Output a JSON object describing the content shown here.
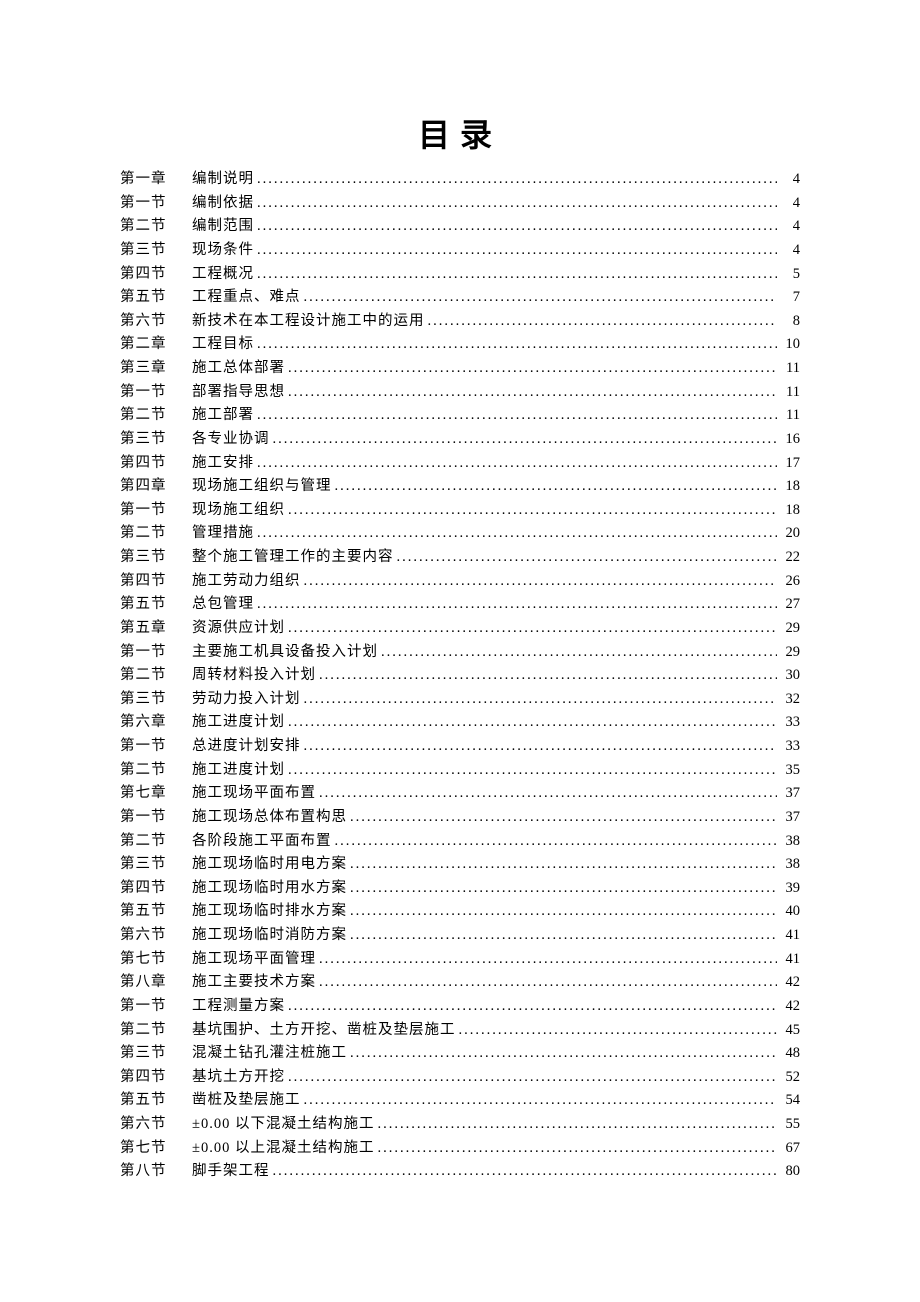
{
  "title": "目录",
  "toc": [
    {
      "label": "第一章",
      "text": "编制说明",
      "page": "4"
    },
    {
      "label": "第一节",
      "text": "编制依据",
      "page": "4"
    },
    {
      "label": "第二节",
      "text": "编制范围",
      "page": "4"
    },
    {
      "label": "第三节",
      "text": "现场条件",
      "page": "4"
    },
    {
      "label": "第四节",
      "text": "工程概况",
      "page": "5"
    },
    {
      "label": "第五节",
      "text": "工程重点、难点",
      "page": "7"
    },
    {
      "label": "第六节",
      "text": "新技术在本工程设计施工中的运用",
      "page": "8"
    },
    {
      "label": "第二章",
      "text": "工程目标",
      "page": "10"
    },
    {
      "label": "第三章",
      "text": "施工总体部署",
      "page": "11"
    },
    {
      "label": "第一节",
      "text": "部署指导思想",
      "page": "11"
    },
    {
      "label": "第二节",
      "text": "施工部署",
      "page": "11"
    },
    {
      "label": "第三节",
      "text": "各专业协调",
      "page": "16"
    },
    {
      "label": "第四节",
      "text": "施工安排",
      "page": "17"
    },
    {
      "label": "第四章",
      "text": "现场施工组织与管理",
      "page": "18"
    },
    {
      "label": "第一节",
      "text": "现场施工组织",
      "page": "18"
    },
    {
      "label": "第二节",
      "text": "管理措施",
      "page": "20"
    },
    {
      "label": "第三节",
      "text": "整个施工管理工作的主要内容",
      "page": "22"
    },
    {
      "label": "第四节",
      "text": "施工劳动力组织",
      "page": "26"
    },
    {
      "label": "第五节",
      "text": "总包管理",
      "page": "27"
    },
    {
      "label": "第五章",
      "text": "资源供应计划",
      "page": "29"
    },
    {
      "label": "第一节",
      "text": "主要施工机具设备投入计划",
      "page": "29"
    },
    {
      "label": "第二节",
      "text": "周转材料投入计划",
      "page": "30"
    },
    {
      "label": "第三节",
      "text": "劳动力投入计划",
      "page": "32"
    },
    {
      "label": "第六章",
      "text": "施工进度计划",
      "page": "33"
    },
    {
      "label": "第一节",
      "text": "总进度计划安排",
      "page": "33"
    },
    {
      "label": "第二节",
      "text": "施工进度计划",
      "page": "35"
    },
    {
      "label": "第七章",
      "text": "施工现场平面布置",
      "page": "37"
    },
    {
      "label": "第一节",
      "text": "施工现场总体布置构思",
      "page": "37"
    },
    {
      "label": "第二节",
      "text": "各阶段施工平面布置",
      "page": "38"
    },
    {
      "label": "第三节",
      "text": "施工现场临时用电方案",
      "page": "38"
    },
    {
      "label": "第四节",
      "text": "施工现场临时用水方案",
      "page": "39"
    },
    {
      "label": "第五节",
      "text": "施工现场临时排水方案",
      "page": "40"
    },
    {
      "label": "第六节",
      "text": "施工现场临时消防方案",
      "page": "41"
    },
    {
      "label": "第七节",
      "text": "施工现场平面管理",
      "page": "41"
    },
    {
      "label": "第八章",
      "text": "施工主要技术方案",
      "page": "42"
    },
    {
      "label": "第一节",
      "text": "工程测量方案",
      "page": "42"
    },
    {
      "label": "第二节",
      "text": "基坑围护、土方开挖、凿桩及垫层施工",
      "page": "45"
    },
    {
      "label": "第三节",
      "text": "混凝土钻孔灌注桩施工",
      "page": "48"
    },
    {
      "label": "第四节",
      "text": "基坑土方开挖",
      "page": "52"
    },
    {
      "label": "第五节",
      "text": "凿桩及垫层施工",
      "page": "54"
    },
    {
      "label": "第六节",
      "text": "±0.00 以下混凝土结构施工",
      "page": "55"
    },
    {
      "label": "第七节",
      "text": "±0.00 以上混凝土结构施工",
      "page": "67"
    },
    {
      "label": "第八节",
      "text": "脚手架工程",
      "page": "80"
    }
  ]
}
